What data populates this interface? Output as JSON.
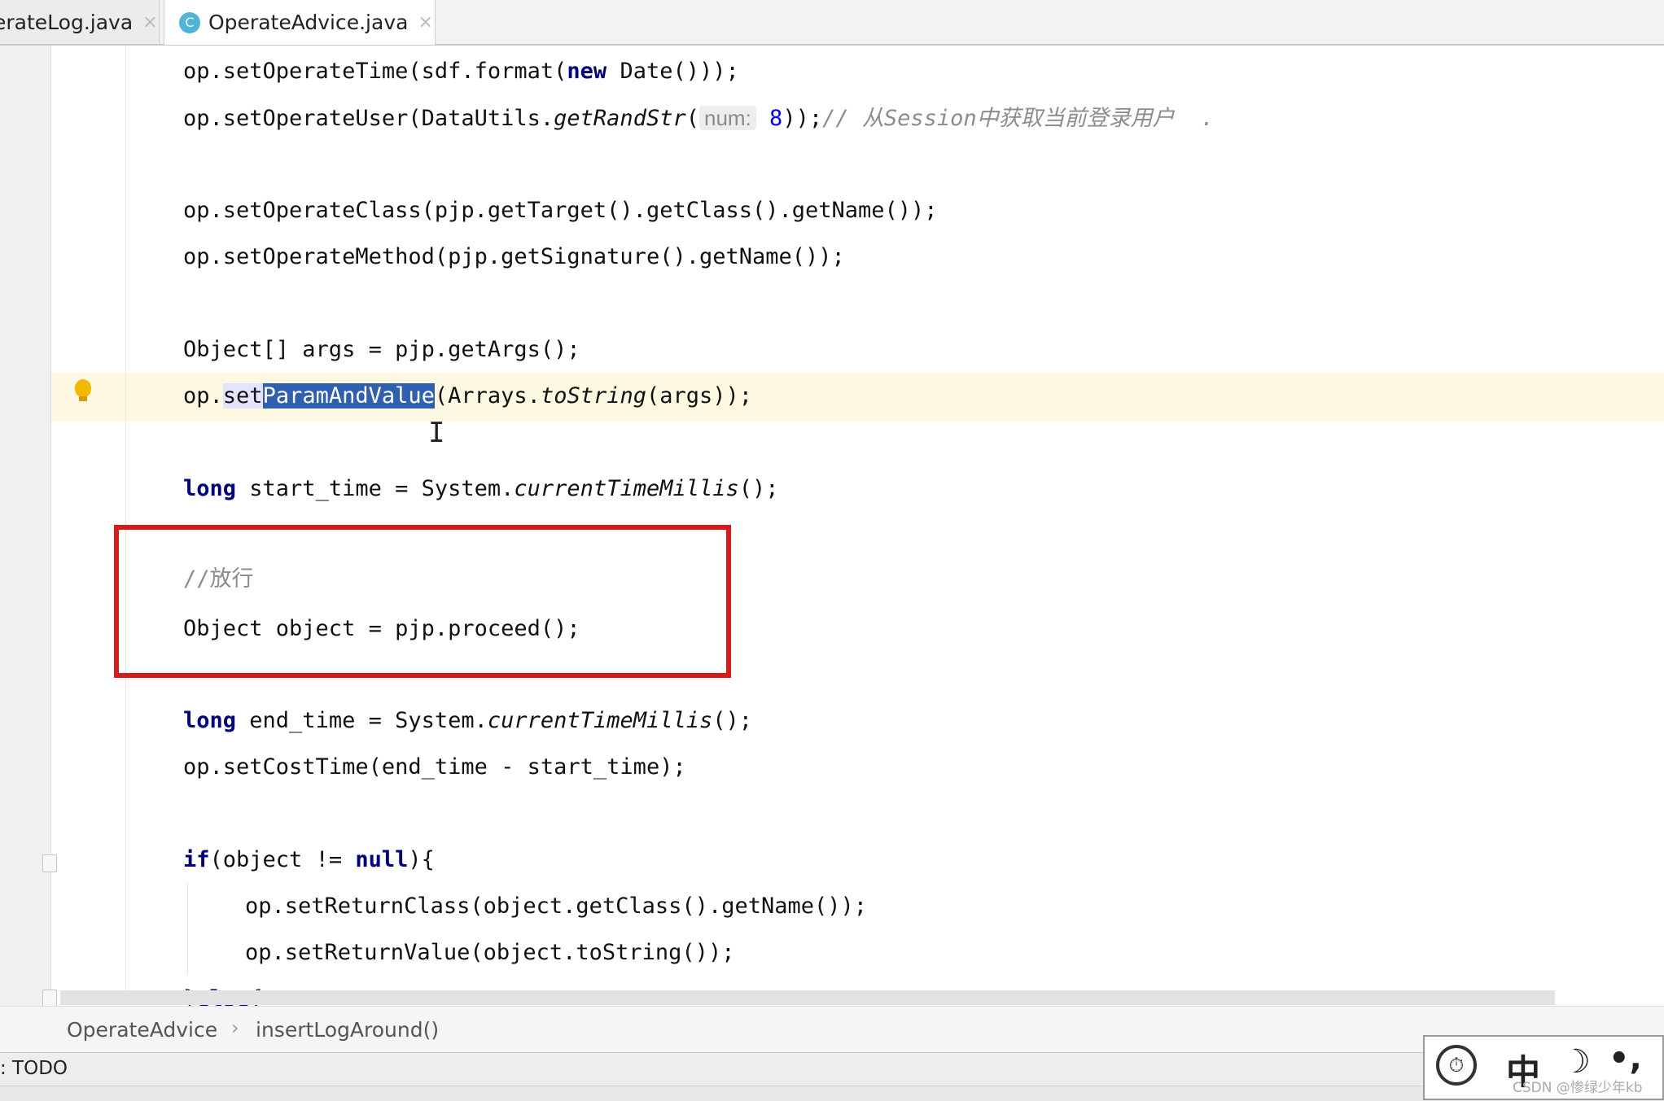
{
  "tabs": [
    {
      "label": "erateLog.java",
      "close": "×",
      "active": false
    },
    {
      "label": "OperateAdvice.java",
      "close": "×",
      "active": true,
      "icon_text": "C"
    }
  ],
  "code": {
    "l1": {
      "a": "op.setOperateTime(sdf.format(",
      "kw": "new",
      "b": " Date()));"
    },
    "l2": {
      "a": "op.setOperateUser(DataUtils.",
      "it": "getRandStr",
      "b": "(",
      "hint": "num:",
      "num": " 8",
      "c": "));",
      "comment": "// 从Session中获取当前登录用户  ."
    },
    "l3": {
      "a": "op.setOperateClass(pjp.getTarget().getClass().getName());"
    },
    "l4": {
      "a": "op.setOperateMethod(pjp.getSignature().getName());"
    },
    "l5": {
      "a": "Object[] args = pjp.getArgs();"
    },
    "l6": {
      "a": "op.",
      "pre": "set",
      "sel": "ParamAndValue",
      "b": "(Arrays.",
      "it": "toString",
      "c": "(args));"
    },
    "l7": {
      "kw": "long",
      "a": " start_time = System.",
      "it": "currentTimeMillis",
      "b": "();"
    },
    "l8": {
      "comment": "//放行"
    },
    "l9": {
      "a": "Object object = pjp.proceed();"
    },
    "l10": {
      "kw": "long",
      "a": " end_time = System.",
      "it": "currentTimeMillis",
      "b": "();"
    },
    "l11": {
      "a": "op.setCostTime(end_time - start_time);"
    },
    "l12": {
      "kw": "if",
      "a": "(object != ",
      "kw2": "null",
      "b": "){"
    },
    "l13": {
      "a": "op.setReturnClass(object.getClass().getName());"
    },
    "l14": {
      "a": "op.setReturnValue(object.toString());"
    },
    "l15": {
      "a": "}",
      "kw": "else",
      "b": "{"
    }
  },
  "breadcrumb": {
    "class": "OperateAdvice",
    "sep": "›",
    "method": "insertLogAround()"
  },
  "toolbar": {
    "todo": ": TODO"
  },
  "ime": {
    "logo": "⏱",
    "lang": "中",
    "moon": "☽",
    "punct": "•,"
  },
  "watermark": "CSDN @惨绿少年kb",
  "colors": {
    "keyword": "#000080",
    "selection": "#2f5fb3",
    "highlight_box": "#d71a1a",
    "comment": "#8c8c8c"
  }
}
